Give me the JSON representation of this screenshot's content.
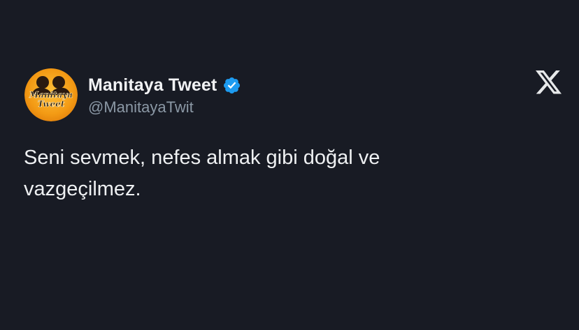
{
  "tweet": {
    "author": {
      "display_name": "Manitaya Tweet",
      "handle": "@ManitayaTwit",
      "verified": true,
      "avatar_icon": "manitaya-logo",
      "avatar_text_line1": "Manitaya",
      "avatar_text_line2": "Tweet"
    },
    "text": "Seni sevmek, nefes almak gibi doğal ve\nvazgeçilmez.",
    "platform_icon": "x-logo-icon"
  },
  "colors": {
    "background": "#181b24",
    "verified_badge": "#1d9bf0",
    "avatar_orange": "#f39a14",
    "handle": "#8b98a5"
  }
}
